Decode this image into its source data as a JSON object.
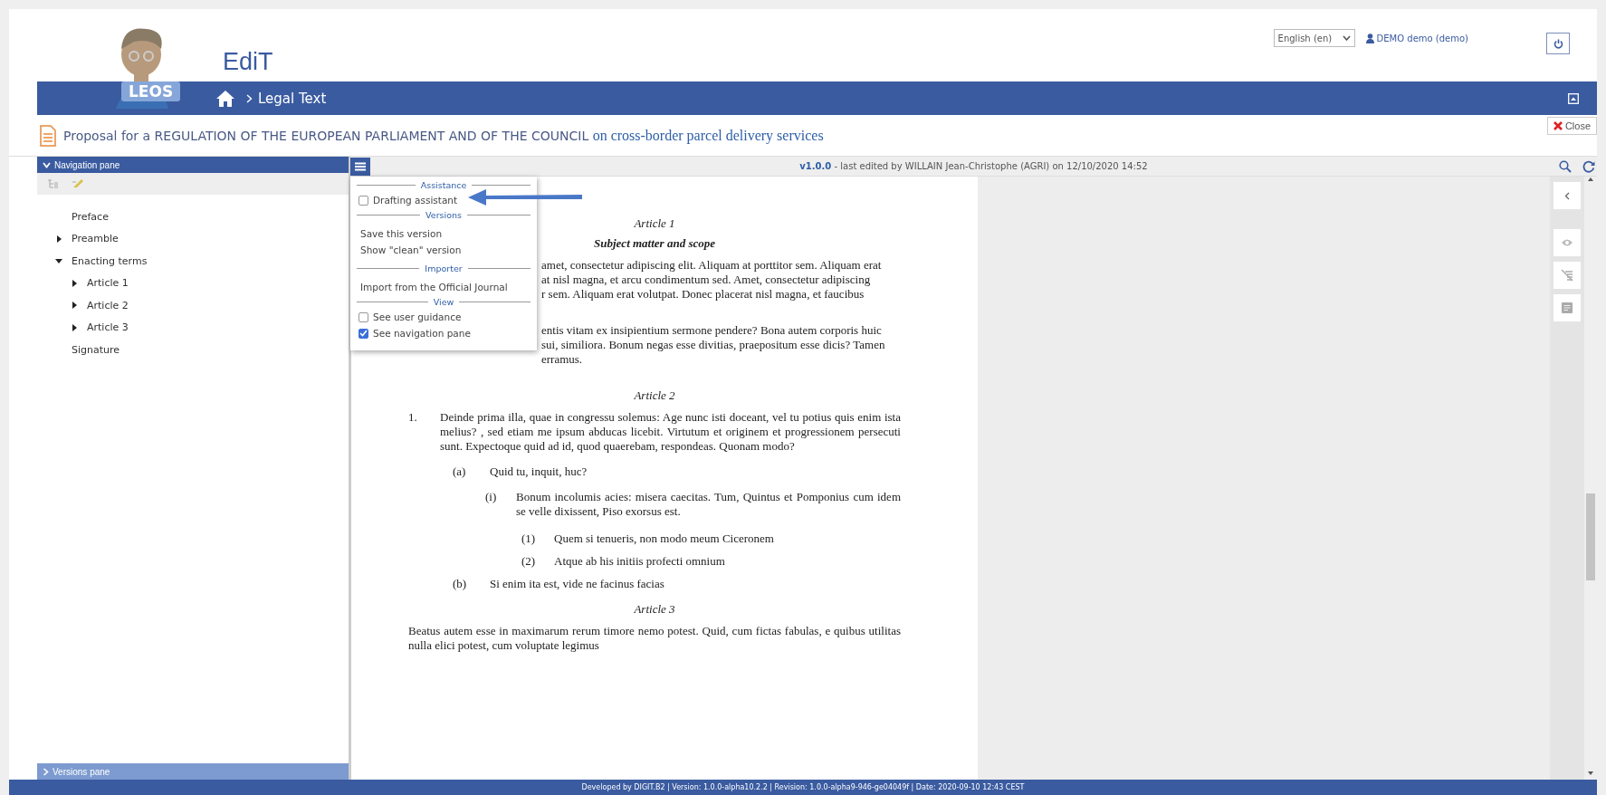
{
  "header": {
    "logo_text": "LEOS",
    "app_title": "EdiT",
    "language": "English (en)",
    "user": "DEMO demo (demo)"
  },
  "breadcrumb": {
    "current": "Legal Text"
  },
  "document_title": {
    "main": "Proposal for a REGULATION OF THE EUROPEAN PARLIAMENT AND OF THE COUNCIL",
    "subject": "on cross-border parcel delivery services",
    "close": "Close"
  },
  "navigation_pane": {
    "title": "Navigation pane",
    "expanded": true,
    "tree": [
      {
        "label": "Preface"
      },
      {
        "label": "Preamble",
        "expanded": false
      },
      {
        "label": "Enacting terms",
        "expanded": true,
        "children": [
          {
            "label": "Article 1",
            "expanded": false
          },
          {
            "label": "Article 2",
            "expanded": false
          },
          {
            "label": "Article 3",
            "expanded": false
          }
        ]
      },
      {
        "label": "Signature"
      }
    ]
  },
  "versions_pane": {
    "title": "Versions pane",
    "expanded": false
  },
  "version_info": "**v1.0.0** - last edited by WILLAIN Jean-Christophe (AGRI) on 12/10/2020 14:52",
  "menu": {
    "sections": [
      {
        "title": "Assistance",
        "items": [
          {
            "kind": "checkbox",
            "label": "Drafting assistant",
            "checked": false
          }
        ]
      },
      {
        "title": "Versions",
        "items": [
          {
            "kind": "action",
            "label": "Save this version"
          },
          {
            "kind": "action",
            "label": "Show \"clean\" version"
          }
        ]
      },
      {
        "title": "Importer",
        "items": [
          {
            "kind": "action",
            "label": "Import from the Official Journal"
          }
        ]
      },
      {
        "title": "View",
        "items": [
          {
            "kind": "checkbox",
            "label": "See user guidance",
            "checked": false
          },
          {
            "kind": "checkbox",
            "label": "See navigation pane",
            "checked": true
          }
        ]
      }
    ]
  },
  "document": {
    "blocks": [
      {
        "kind": "heading",
        "text": "Article 1"
      },
      {
        "kind": "subheading",
        "text": "Subject matter and scope"
      },
      {
        "kind": "covered",
        "lines": [
          "amet, consectetur adipiscing elit. Aliquam at porttitor sem.  Aliquam erat",
          "at nisl magna, et  arcu condimentum sed. Amet, consectetur adipiscing",
          "r sem.  Aliquam erat volutpat. Donec placerat nisl magna, et faucibus"
        ]
      },
      {
        "kind": "covered",
        "lines": [
          "entis vitam ex insipientium sermone pendere? Bona autem corporis huic",
          "sui, similiora. Bonum negas esse divitias, praepositum esse dicis? Tamen",
          "erramus."
        ]
      },
      {
        "kind": "heading",
        "text": "Article  2"
      },
      {
        "kind": "paragraph",
        "num": "1.",
        "text": "Deinde prima illa, quae in congressu solemus:   Age nunc isti doceant, vel tu potius quis enim ista melius? , sed etiam me ipsum abducas licebit. Virtutum et originem et progressionem persecuti sunt. Expectoque quid ad id, quod quaerebam, respondeas. Quonam modo?"
      },
      {
        "kind": "point",
        "num": "(a)",
        "text": "Quid tu, inquit, huc?"
      },
      {
        "kind": "subpoint",
        "num": "(i)",
        "text": "Bonum incolumis acies: misera caecitas. Tum, Quintus et Pomponius cum idem se velle dixissent, Piso exorsus est."
      },
      {
        "kind": "indent",
        "num": "(1)",
        "text": "Quem si tenueris, non modo meum Ciceronem"
      },
      {
        "kind": "indent",
        "num": "(2)",
        "text": "Atque ab his initiis profecti omnium"
      },
      {
        "kind": "point",
        "num": "(b)",
        "text": "Si enim ita est, vide ne facinus facias"
      },
      {
        "kind": "heading",
        "text": "Article 3"
      },
      {
        "kind": "plain",
        "text": "Beatus autem esse in maximarum rerum timore nemo potest. Quid, cum fictas fabulas, e quibus utilitas nulla elici potest, cum voluptate legimus"
      }
    ]
  },
  "footer": "Developed by DIGIT.B2 | Version: 1.0.0-alpha10.2.2 | Revision: 1.0.0-alpha9-946-ge04049f | Date: 2020-09-10 12:43 CEST"
}
